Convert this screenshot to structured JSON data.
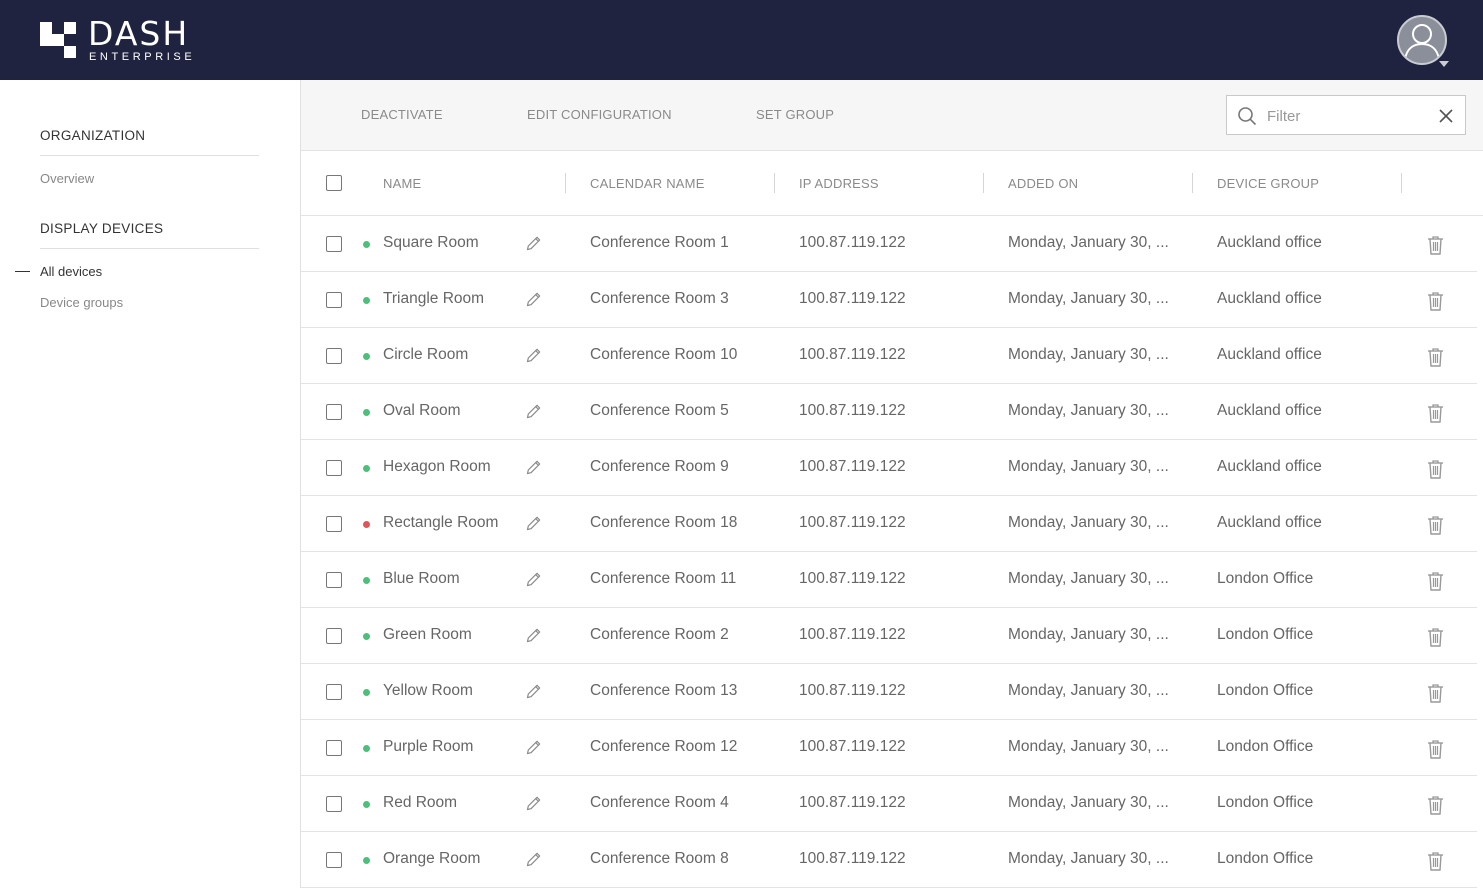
{
  "app": {
    "logo_title": "DASH",
    "logo_subtitle": "ENTERPRISE"
  },
  "sidebar": {
    "sections": [
      {
        "heading": "ORGANIZATION",
        "items": [
          {
            "label": "Overview",
            "active": false
          }
        ]
      },
      {
        "heading": "DISPLAY DEVICES",
        "items": [
          {
            "label": "All devices",
            "active": true
          },
          {
            "label": "Device groups",
            "active": false
          }
        ]
      }
    ]
  },
  "toolbar": {
    "deactivate_label": "DEACTIVATE",
    "edit_config_label": "EDIT CONFIGURATION",
    "set_group_label": "SET GROUP",
    "filter_placeholder": "Filter"
  },
  "table": {
    "columns": [
      "NAME",
      "CALENDAR NAME",
      "IP ADDRESS",
      "ADDED ON",
      "DEVICE GROUP"
    ],
    "rows": [
      {
        "status": "online",
        "name": "Square Room",
        "calendar": "Conference Room 1",
        "ip": "100.87.119.122",
        "added": "Monday, January 30, ...",
        "group": "Auckland office"
      },
      {
        "status": "online",
        "name": "Triangle Room",
        "calendar": "Conference Room 3",
        "ip": "100.87.119.122",
        "added": "Monday, January 30, ...",
        "group": "Auckland office"
      },
      {
        "status": "online",
        "name": "Circle Room",
        "calendar": "Conference Room 10",
        "ip": "100.87.119.122",
        "added": "Monday, January 30, ...",
        "group": "Auckland office"
      },
      {
        "status": "online",
        "name": "Oval Room",
        "calendar": "Conference Room 5",
        "ip": "100.87.119.122",
        "added": "Monday, January 30, ...",
        "group": "Auckland office"
      },
      {
        "status": "online",
        "name": "Hexagon Room",
        "calendar": "Conference Room 9",
        "ip": "100.87.119.122",
        "added": "Monday, January 30, ...",
        "group": "Auckland office"
      },
      {
        "status": "offline",
        "name": "Rectangle Room",
        "calendar": "Conference Room 18",
        "ip": "100.87.119.122",
        "added": "Monday, January 30, ...",
        "group": "Auckland office"
      },
      {
        "status": "online",
        "name": "Blue Room",
        "calendar": "Conference Room 11",
        "ip": "100.87.119.122",
        "added": "Monday, January 30, ...",
        "group": "London Office"
      },
      {
        "status": "online",
        "name": "Green Room",
        "calendar": "Conference Room 2",
        "ip": "100.87.119.122",
        "added": "Monday, January 30, ...",
        "group": "London Office"
      },
      {
        "status": "online",
        "name": "Yellow Room",
        "calendar": "Conference Room 13",
        "ip": "100.87.119.122",
        "added": "Monday, January 30, ...",
        "group": "London Office"
      },
      {
        "status": "online",
        "name": "Purple Room",
        "calendar": "Conference Room 12",
        "ip": "100.87.119.122",
        "added": "Monday, January 30, ...",
        "group": "London Office"
      },
      {
        "status": "online",
        "name": "Red Room",
        "calendar": "Conference Room 4",
        "ip": "100.87.119.122",
        "added": "Monday, January 30, ...",
        "group": "London Office"
      },
      {
        "status": "online",
        "name": "Orange Room",
        "calendar": "Conference Room 8",
        "ip": "100.87.119.122",
        "added": "Monday, January 30, ...",
        "group": "London Office"
      }
    ]
  },
  "icons": {
    "row_edit": "pencil-icon",
    "row_delete": "trash-icon",
    "filter_search": "search-icon",
    "filter_clear": "close-icon",
    "user": "user-avatar-icon"
  },
  "colors": {
    "header_bg": "#1f2340",
    "status_online": "#4cbf7a",
    "status_offline": "#e0555a",
    "toolbar_bg": "#f6f6f6"
  }
}
